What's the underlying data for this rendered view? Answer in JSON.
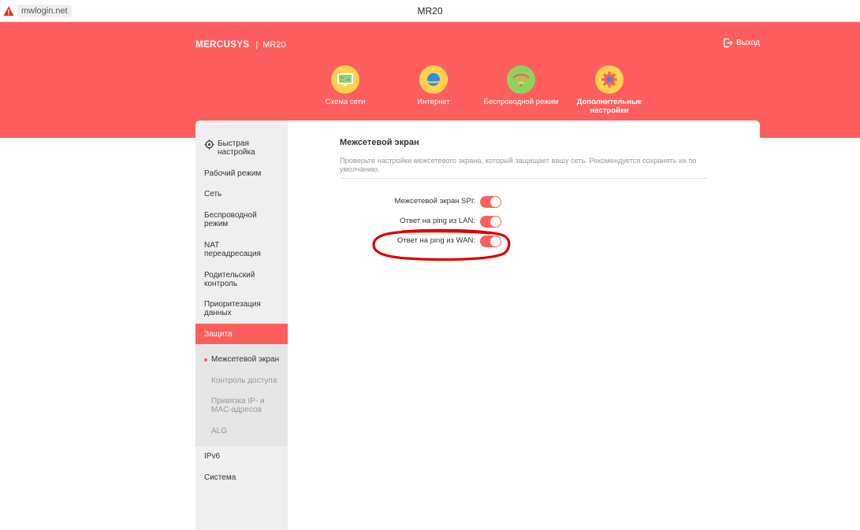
{
  "browser": {
    "url": "mwlogin.net",
    "title": "MR20"
  },
  "header": {
    "brand": "MERCUSYS",
    "separator": "|",
    "model": "MR20",
    "logout_label": "Выход",
    "nav": [
      {
        "label": "Схема сети",
        "icon": "network-map-icon"
      },
      {
        "label": "Интернет",
        "icon": "internet-planet-icon"
      },
      {
        "label": "Беспроводной режим",
        "icon": "wifi-icon"
      },
      {
        "label": "Дополнительные настройки",
        "icon": "gear-icon",
        "active": true
      }
    ]
  },
  "sidebar": {
    "quick_setup": "Быстрая настройка",
    "items": [
      "Рабочий режим",
      "Сеть",
      "Беспроводной режим",
      "NAT переадресация",
      "Родительский контроль",
      "Приоритезация данных",
      "Защита",
      "IPv6",
      "Система"
    ],
    "active": "Защита",
    "sub_items": [
      "Межсетевой экран",
      "Контроль доступа",
      "Привязка IP- и MAC-адресов",
      "ALG"
    ],
    "current_sub": "Межсетевой экран"
  },
  "content": {
    "title": "Межсетевой экран",
    "description": "Проверьте настройки межсетевого экрана, который защищает вашу сеть. Рекомендуется сохранять их по умолчанию.",
    "settings": [
      {
        "label": "Межсетевой экран SPI:",
        "enabled": true
      },
      {
        "label": "Ответ на ping из LAN:",
        "enabled": true
      },
      {
        "label": "Ответ на ping из WAN:",
        "enabled": true
      }
    ]
  },
  "colors": {
    "accent": "#fd5f5e",
    "annotation": "#e00000",
    "nav_icon_bg": "#ffd24d"
  }
}
